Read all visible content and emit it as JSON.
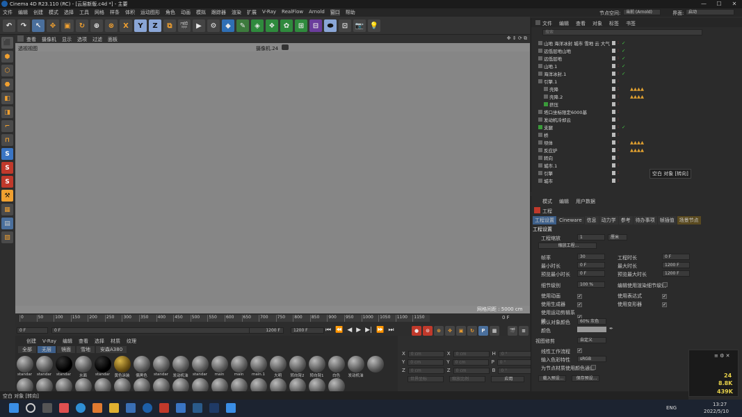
{
  "app": {
    "title": "Cinema 4D R23.110 (RC) - [云层新版.c4d *] - 主要"
  },
  "menubar": [
    "文件",
    "编辑",
    "创建",
    "模式",
    "选择",
    "工具",
    "网格",
    "样条",
    "体积",
    "运动图形",
    "角色",
    "动画",
    "模拟",
    "跟踪器",
    "渲染",
    "扩展",
    "V-Ray",
    "RealFlow",
    "Arnold",
    "窗口",
    "帮助"
  ],
  "viewport_menu": [
    "查看",
    "摄像机",
    "显示",
    "选项",
    "过滤",
    "面板"
  ],
  "viewport": {
    "label": "透视视图",
    "camera": "摄像机.24",
    "grid_note": "网格间距 : 5000 cm"
  },
  "timeline": {
    "ticks": [
      "0",
      "50",
      "100",
      "150",
      "200",
      "250",
      "300",
      "350",
      "400",
      "450",
      "500",
      "550",
      "600",
      "650",
      "700",
      "750",
      "800",
      "850",
      "900",
      "950",
      "1000",
      "1050",
      "1100",
      "1150"
    ],
    "current": "0 F",
    "start": "0 F",
    "end": "1200 F",
    "end2": "1200 F",
    "frame_right": "0 F"
  },
  "material_manager": {
    "menu": [
      "创建",
      "V-Ray",
      "编辑",
      "查看",
      "选择",
      "材质",
      "纹理"
    ],
    "filters": [
      "全部",
      "无层",
      "镜面",
      "雪地",
      "安森A380"
    ],
    "row1": [
      "standar",
      "standar",
      "standar",
      "水面",
      "standar",
      "黄色涂装",
      "偶黑色",
      "standar",
      "发动机油",
      "standar",
      "main",
      "main",
      "main.1",
      "大明",
      "转向臂2",
      "转向臂1",
      "白色",
      "发动机油"
    ]
  },
  "coords": {
    "labels": [
      "X",
      "Y",
      "Z"
    ],
    "pos": "0 cm",
    "size": "0 cm",
    "rot": [
      "H",
      "P",
      "B"
    ],
    "rot_val": "0 °",
    "mode1": "世界坐标",
    "mode2": "缩放比例",
    "apply": "应用"
  },
  "object_manager": {
    "header_right_label": "节点空间:",
    "node_space": "当前 (Arnold)",
    "interface_label": "界面:",
    "interface": "启动",
    "menu": [
      "文件",
      "编辑",
      "查看",
      "对象",
      "标签",
      "书签"
    ],
    "search_placeholder": "搜索",
    "rows": [
      {
        "name": "山地 海洋冰封 城市 雪地 云 大气",
        "indent": 0
      },
      {
        "name": "远低层地山地",
        "indent": 0
      },
      {
        "name": "远低层地",
        "indent": 0
      },
      {
        "name": "山地.1",
        "indent": 0
      },
      {
        "name": "海洋冰封.1",
        "indent": 0
      },
      {
        "name": "引擎.1",
        "indent": 0
      },
      {
        "name": "壳降",
        "indent": 1
      },
      {
        "name": "壳降.2",
        "indent": 1
      },
      {
        "name": "挤压",
        "indent": 1
      },
      {
        "name": "塔口坐标限定6000基",
        "indent": 0
      },
      {
        "name": "发动机冷却云",
        "indent": 0
      },
      {
        "name": "支腿",
        "indent": 0
      },
      {
        "name": "桥",
        "indent": 0
      },
      {
        "name": "坝体",
        "indent": 0
      },
      {
        "name": "反应炉",
        "indent": 0
      },
      {
        "name": "转向",
        "indent": 0
      },
      {
        "name": "城市.1",
        "indent": 0
      },
      {
        "name": "引擎",
        "indent": 0
      },
      {
        "name": "城市",
        "indent": 0
      }
    ],
    "tooltip": "空白 对象 [转向]"
  },
  "attributes": {
    "menu": [
      "模式",
      "编辑",
      "用户数据"
    ],
    "title": "工程",
    "tabs": [
      "工程设置",
      "Cineware",
      "信息",
      "动力学",
      "参考",
      "待办事项",
      "帧插值",
      "场景节点"
    ],
    "section": "工程设置",
    "scale_label": "工程缩放",
    "scale_value": "1",
    "scale_unit": "厘米",
    "scale_btn": "缩放工程...",
    "fps_label": "帧率",
    "fps": "30",
    "min_label": "最小时长",
    "min": "0 F",
    "preview_min_label": "预览最小时长",
    "preview_min": "0 F",
    "length_label": "工程时长",
    "length": "0 F",
    "max_label": "最大时长",
    "max": "1200 F",
    "preview_max_label": "预览最大时长",
    "preview_max": "1200 F",
    "lod_label": "细节级别",
    "lod": "100 %",
    "lod2_label": "编辑使用渲染细节级别",
    "checks_left": [
      "使用动画",
      "使用生成器",
      "使用运动剪辑系统"
    ],
    "checks_right": [
      "使用表达式",
      "使用变形器"
    ],
    "default_color_label": "默认对象颜色",
    "default_color": "60% 灰色",
    "color_label": "颜色",
    "view_clip_label": "视图修剪",
    "view_clip": "自定义",
    "linear_label": "线性工作流程",
    "input_color_label": "输入色彩特性",
    "input_color": "sRGB",
    "vertex_label": "为节点材质使用颜色通道",
    "load_btn": "载入预设...",
    "save_btn": "保存预设..."
  },
  "status": {
    "text": "空白 对象 [转向]"
  },
  "stats": {
    "a": "24",
    "b": "8.8K",
    "c": "439K"
  },
  "taskbar": {
    "lang": "ENG",
    "time": "13:27",
    "date": "2022/5/10"
  }
}
